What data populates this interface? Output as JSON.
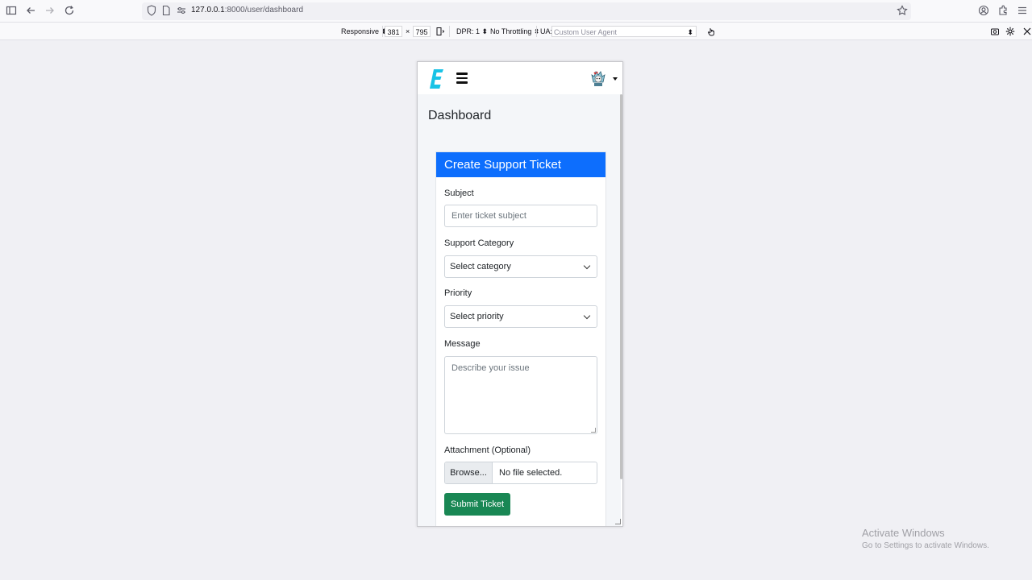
{
  "browser": {
    "url_host": "127.0.0.1",
    "url_path": ":8000/user/dashboard"
  },
  "rdm": {
    "device": "Responsive ⬍",
    "width": "381",
    "times": "×",
    "height": "795",
    "dpr": "DPR: 1 ⬍",
    "throttling": "No Throttling ⬍",
    "ua_label": "UA:",
    "ua_value": "Custom User Agent"
  },
  "app": {
    "page_title": "Dashboard",
    "card_title": "Create Support Ticket",
    "subject": {
      "label": "Subject",
      "placeholder": "Enter ticket subject"
    },
    "category": {
      "label": "Support Category",
      "value": "Select category"
    },
    "priority": {
      "label": "Priority",
      "value": "Select priority"
    },
    "message": {
      "label": "Message",
      "placeholder": "Describe your issue"
    },
    "attachment": {
      "label": "Attachment (Optional)",
      "button": "Browse...",
      "status": "No file selected."
    },
    "submit": "Submit Ticket"
  },
  "watermark": {
    "title": "Activate Windows",
    "subtitle": "Go to Settings to activate Windows."
  },
  "colors": {
    "primary": "#0d6efd",
    "success": "#198754",
    "logo": "#19c3e6"
  }
}
